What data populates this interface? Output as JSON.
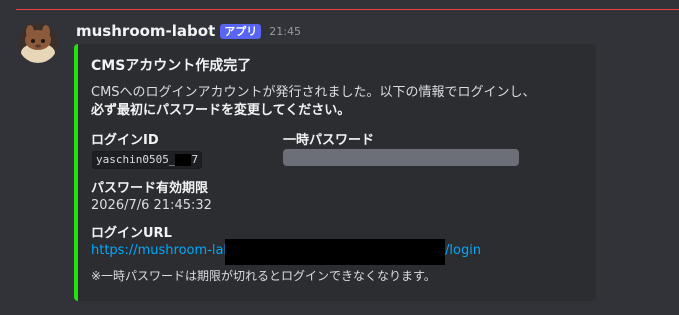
{
  "message": {
    "username": "mushroom-labot",
    "app_tag": "アプリ",
    "timestamp": "21:45"
  },
  "embed": {
    "accent_color": "#22e312",
    "title": "CMSアカウント作成完了",
    "description_line1": "CMSへのログインアカウントが発行されました。以下の情報でログインし、",
    "description_line2": "必ず最初にパスワードを変更してください。",
    "fields": {
      "login_id": {
        "name": "ログインID",
        "value_prefix": "yaschin0505_",
        "value_suffix": "7"
      },
      "temp_password": {
        "name": "一時パスワード"
      },
      "password_expiry": {
        "name": "パスワード有効期限",
        "value": "2026/7/6 21:45:32"
      },
      "login_url": {
        "name": "ログインURL",
        "link_start": "https://mushroom-lab",
        "link_end": "/login"
      }
    },
    "footer_note": "※一時パスワードは期限が切れるとログインできなくなります。"
  }
}
